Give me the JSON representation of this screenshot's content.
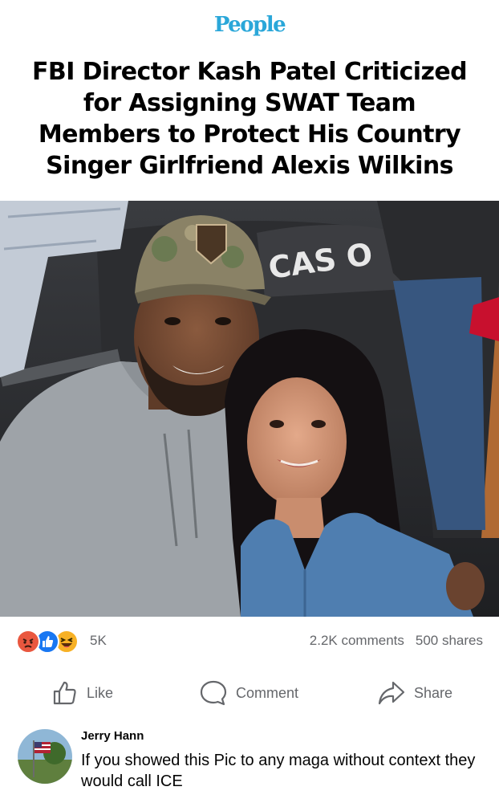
{
  "article": {
    "brand": "People",
    "headline": "FBI Director Kash Patel Criticized for Assigning SWAT Team Members to Protect His Country Singer Girlfriend Alexis Wilkins",
    "photo_sign_text": "CAS O"
  },
  "reactions": {
    "icons": [
      "angry-icon",
      "like-icon",
      "haha-icon"
    ],
    "count": "5K",
    "comments": "2.2K comments",
    "shares": "500 shares"
  },
  "actions": {
    "like_label": "Like",
    "comment_label": "Comment",
    "share_label": "Share"
  },
  "comment": {
    "author": "Jerry Hann",
    "text": "If you showed this Pic to any maga without context they would call ICE"
  },
  "colors": {
    "brand": "#2aa7d9",
    "meta_text": "#65676b",
    "like_blue": "#1877f2",
    "angry": "#e9573f",
    "haha": "#f7b125"
  }
}
